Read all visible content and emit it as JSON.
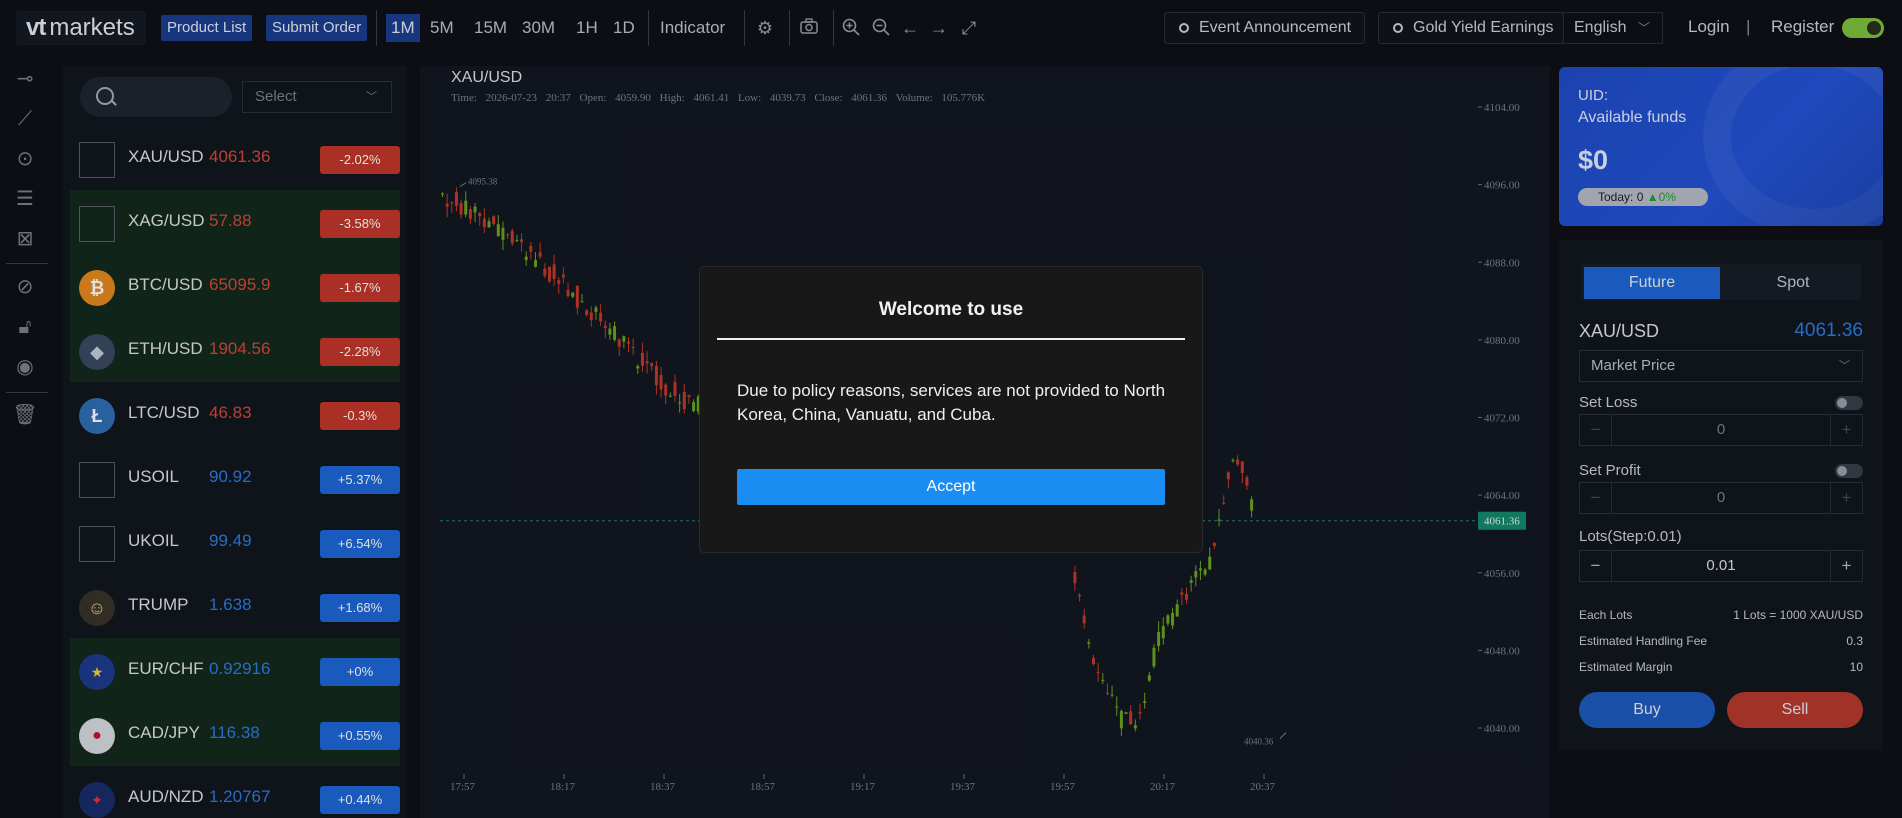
{
  "topbar": {
    "logo_mark": "vt",
    "logo_text": "markets",
    "product_list": "Product List",
    "submit_order": "Submit Order",
    "timeframes": [
      "1M",
      "5M",
      "15M",
      "30M",
      "1H",
      "1D"
    ],
    "indicator": "Indicator",
    "event_announcement": "Event Announcement",
    "gold_yield": "Gold Yield Earnings",
    "language": "English",
    "login": "Login",
    "divider": "|",
    "register": "Register"
  },
  "market_list": {
    "search_placeholder": "",
    "select_placeholder": "Select",
    "items": [
      {
        "symbol": "XAU/USD",
        "price": "4061.36",
        "change": "-2.02%",
        "dir": "down"
      },
      {
        "symbol": "XAG/USD",
        "price": "57.88",
        "change": "-3.58%",
        "dir": "down"
      },
      {
        "symbol": "BTC/USD",
        "price": "65095.9",
        "change": "-1.67%",
        "dir": "down"
      },
      {
        "symbol": "ETH/USD",
        "price": "1904.56",
        "change": "-2.28%",
        "dir": "down"
      },
      {
        "symbol": "LTC/USD",
        "price": "46.83",
        "change": "-0.3%",
        "dir": "down"
      },
      {
        "symbol": "USOIL",
        "price": "90.92",
        "change": "+5.37%",
        "dir": "up"
      },
      {
        "symbol": "UKOIL",
        "price": "99.49",
        "change": "+6.54%",
        "dir": "up"
      },
      {
        "symbol": "TRUMP",
        "price": "1.638",
        "change": "+1.68%",
        "dir": "up"
      },
      {
        "symbol": "EUR/CHF",
        "price": "0.92916",
        "change": "+0%",
        "dir": "up"
      },
      {
        "symbol": "CAD/JPY",
        "price": "116.38",
        "change": "+0.55%",
        "dir": "up"
      },
      {
        "symbol": "AUD/NZD",
        "price": "1.20767",
        "change": "+0.44%",
        "dir": "up"
      }
    ]
  },
  "chart": {
    "symbol": "XAU/USD",
    "info": "Time: 2026-07-23 20:37   Open: 4059.90   High: 4061.41   Low: 4039.73   Close: 4061.36   Volume: 105.776K",
    "y_ticks": [
      "4104.00",
      "4096.00",
      "4088.00",
      "4080.00",
      "4072.00",
      "4064.00",
      "4056.00",
      "4048.00",
      "4040.00"
    ],
    "x_ticks": [
      "17:57",
      "18:17",
      "18:37",
      "18:57",
      "19:17",
      "19:37",
      "19:57",
      "20:17",
      "20:37"
    ],
    "last_price": "4061.36",
    "high_mark": "4095.38",
    "low_mark": "4040.36"
  },
  "modal": {
    "title": "Welcome to use",
    "text": "Due to policy reasons, services are not provided to North Korea, China, Vanuatu, and Cuba.",
    "accept": "Accept"
  },
  "account": {
    "uid_label": "UID:",
    "funds_label": "Available funds",
    "amount": "$0",
    "today_label": "Today: 0",
    "today_change": "▲0%"
  },
  "trade": {
    "tab_future": "Future",
    "tab_spot": "Spot",
    "symbol": "XAU/USD",
    "price": "4061.36",
    "order_type": "Market Price",
    "set_loss": "Set Loss",
    "loss_value": "0",
    "set_profit": "Set Profit",
    "profit_value": "0",
    "lots_label": "Lots(Step:0.01)",
    "lots_value": "0.01",
    "minus": "−",
    "plus": "+",
    "each_lots_label": "Each Lots",
    "each_lots_value": "1 Lots = 1000 XAU/USD",
    "fee_label": "Estimated Handling Fee",
    "fee_value": "0.3",
    "margin_label": "Estimated Margin",
    "margin_value": "10",
    "buy": "Buy",
    "sell": "Sell"
  },
  "colors": {
    "up_candle": "#6ca61e",
    "down_candle": "#c53a2b",
    "accent_blue": "#1d67d6",
    "accept_blue": "#1a8cf2"
  }
}
